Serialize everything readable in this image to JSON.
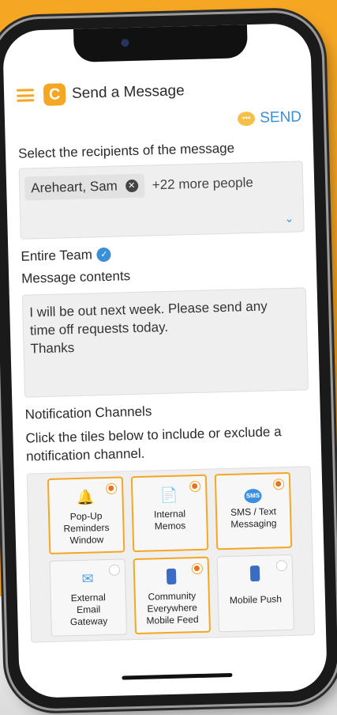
{
  "app": {
    "title": "Send a Message"
  },
  "header": {
    "send_label": "SEND"
  },
  "recipients": {
    "label": "Select the recipients of the message",
    "chip": "Areheart, Sam",
    "more": "+22 more people"
  },
  "team": {
    "label": "Entire Team"
  },
  "message": {
    "label": "Message contents",
    "lines": [
      "I will be out next week. Please send any",
      "time off requests today.",
      "Thanks"
    ]
  },
  "channels": {
    "title": "Notification Channels",
    "help": "Click the tiles below to include or exclude a notification channel.",
    "tiles": [
      {
        "label_lines": [
          "Pop-Up",
          "Reminders",
          "Window"
        ],
        "icon": "bell-icon",
        "selected": true
      },
      {
        "label_lines": [
          "Internal",
          "Memos"
        ],
        "icon": "memo-icon",
        "selected": true
      },
      {
        "label_lines": [
          "SMS / Text",
          "Messaging"
        ],
        "icon": "sms-icon",
        "icon_text": "SMS",
        "selected": true
      },
      {
        "label_lines": [
          "External",
          "Email",
          "Gateway"
        ],
        "icon": "mail-icon",
        "selected": false
      },
      {
        "label_lines": [
          "Community",
          "Everywhere",
          "Mobile Feed"
        ],
        "icon": "device-icon",
        "selected": true
      },
      {
        "label_lines": [
          "Mobile Push"
        ],
        "icon": "phone-icon",
        "selected": false
      }
    ]
  },
  "colors": {
    "accent": "#f5a623",
    "link": "#3a8fd8",
    "selected_dot": "#f0701a"
  }
}
